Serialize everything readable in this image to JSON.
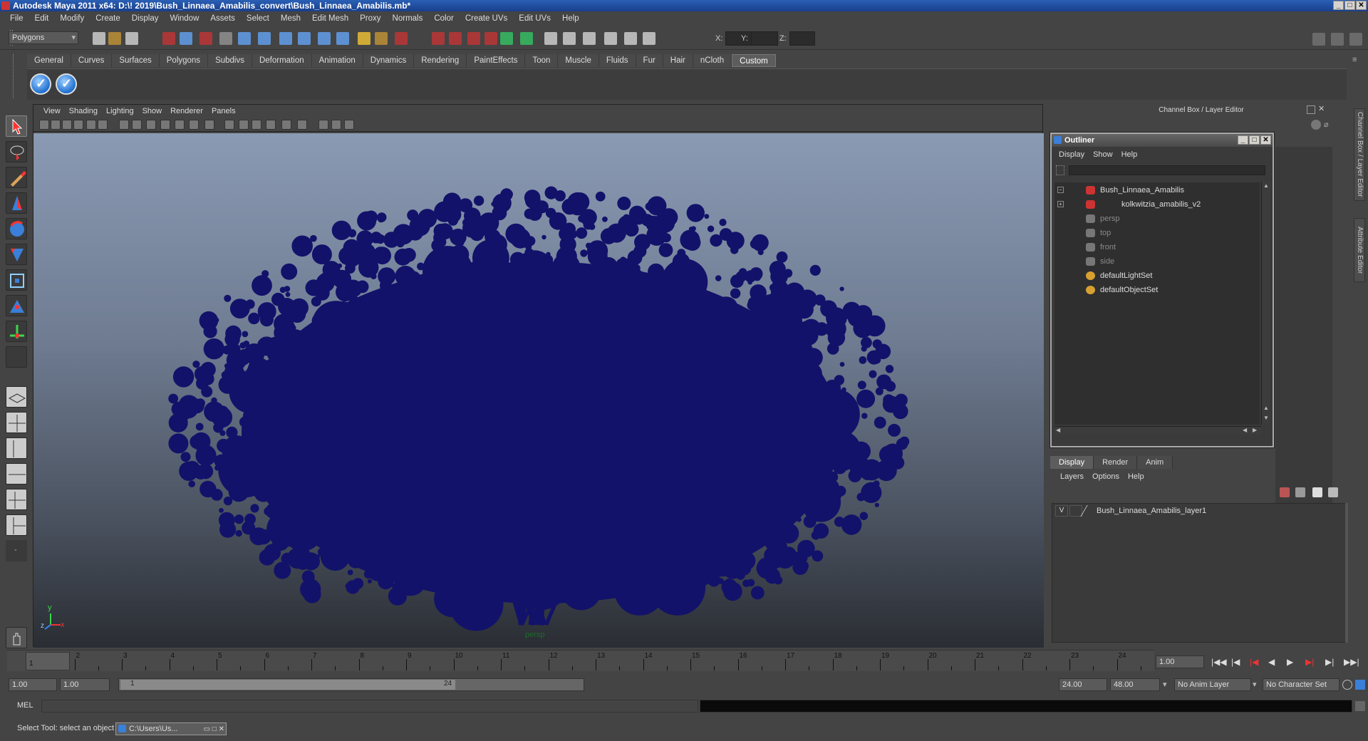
{
  "window": {
    "title": "Autodesk Maya 2011 x64: D:\\! 2019\\Bush_Linnaea_Amabilis_convert\\Bush_Linnaea_Amabilis.mb*"
  },
  "menubar": [
    "File",
    "Edit",
    "Modify",
    "Create",
    "Display",
    "Window",
    "Assets",
    "Select",
    "Mesh",
    "Edit Mesh",
    "Proxy",
    "Normals",
    "Color",
    "Create UVs",
    "Edit UVs",
    "Help"
  ],
  "statusline": {
    "mode": "Polygons",
    "x_label": "X:",
    "y_label": "Y:",
    "z_label": "Z:"
  },
  "shelf": {
    "tabs": [
      "General",
      "Curves",
      "Surfaces",
      "Polygons",
      "Subdivs",
      "Deformation",
      "Animation",
      "Dynamics",
      "Rendering",
      "PaintEffects",
      "Toon",
      "Muscle",
      "Fluids",
      "Fur",
      "Hair",
      "nCloth",
      "Custom"
    ],
    "active_tab": "Custom"
  },
  "viewport": {
    "menu": [
      "View",
      "Shading",
      "Lighting",
      "Show",
      "Renderer",
      "Panels"
    ],
    "camera": "persp",
    "axis_x": "x",
    "axis_y": "y",
    "axis_z": "z",
    "mesh_color": "#12126a"
  },
  "channel_box": {
    "title": "Channel Box / Layer Editor"
  },
  "outliner": {
    "title": "Outliner",
    "menu": [
      "Display",
      "Show",
      "Help"
    ],
    "items": [
      {
        "label": "Bush_Linnaea_Amabilis",
        "type": "mesh"
      },
      {
        "label": "kolkwitzia_amabilis_v2",
        "type": "mesh"
      },
      {
        "label": "persp",
        "type": "camera"
      },
      {
        "label": "top",
        "type": "camera"
      },
      {
        "label": "front",
        "type": "camera"
      },
      {
        "label": "side",
        "type": "camera"
      },
      {
        "label": "defaultLightSet",
        "type": "set"
      },
      {
        "label": "defaultObjectSet",
        "type": "set"
      }
    ]
  },
  "layer_editor": {
    "tabs": [
      "Display",
      "Render",
      "Anim"
    ],
    "active_tab": "Display",
    "menu": [
      "Layers",
      "Options",
      "Help"
    ],
    "layers": [
      {
        "visible": "V",
        "name": "Bush_Linnaea_Amabilis_layer1"
      }
    ]
  },
  "side_tabs": [
    "Channel Box / Layer Editor",
    "Attribute Editor"
  ],
  "timeline": {
    "ticks": [
      "1",
      "2",
      "3",
      "4",
      "5",
      "6",
      "7",
      "8",
      "9",
      "10",
      "11",
      "12",
      "13",
      "14",
      "15",
      "16",
      "17",
      "18",
      "19",
      "20",
      "21",
      "22",
      "23",
      "24"
    ],
    "current_time": "1.00",
    "current_frame": "1"
  },
  "range": {
    "start_time": "1.00",
    "playback_start": "1.00",
    "slider_start": "1",
    "slider_end": "24",
    "playback_end": "24.00",
    "end_time": "48.00",
    "anim_layer": "No Anim Layer",
    "character_set": "No Character Set"
  },
  "command_line": {
    "label": "MEL"
  },
  "status": {
    "help_text": "Select Tool: select an object",
    "task_window": "C:\\Users\\Us..."
  }
}
